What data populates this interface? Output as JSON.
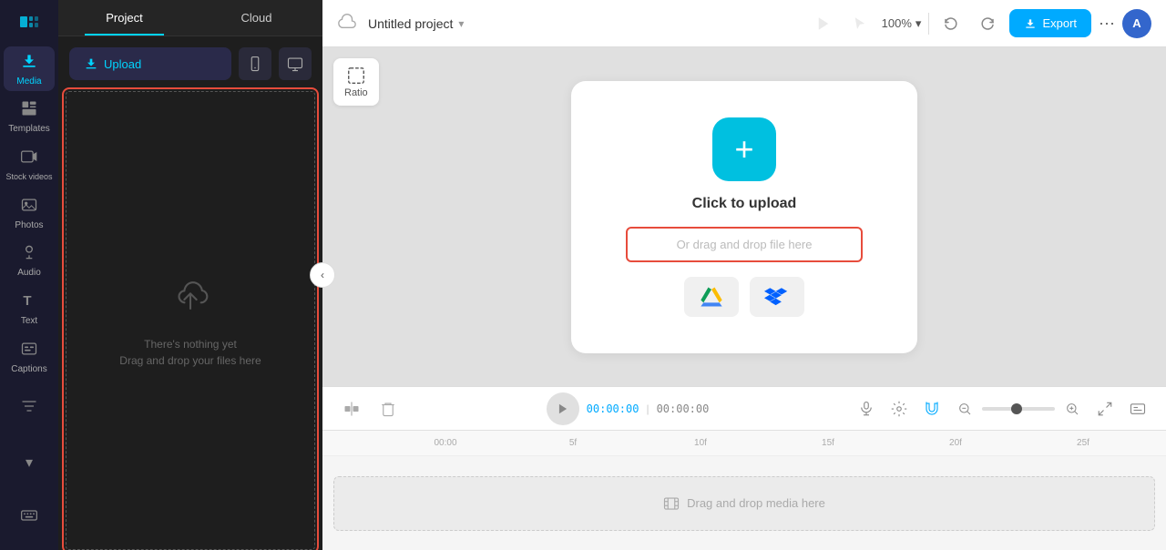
{
  "iconbar": {
    "logo_icon": "✕",
    "items": [
      {
        "id": "media",
        "label": "Media",
        "icon": "⬆",
        "active": true
      },
      {
        "id": "templates",
        "label": "Templates",
        "icon": "⊞",
        "active": false
      },
      {
        "id": "stock_videos",
        "label": "Stock videos",
        "icon": "▦",
        "active": false
      },
      {
        "id": "photos",
        "label": "Photos",
        "icon": "⊡",
        "active": false
      },
      {
        "id": "audio",
        "label": "Audio",
        "icon": "♪",
        "active": false
      },
      {
        "id": "text",
        "label": "Text",
        "icon": "T",
        "active": false
      },
      {
        "id": "captions",
        "label": "Captions",
        "icon": "☰",
        "active": false
      }
    ],
    "bottom_items": [
      {
        "id": "filter",
        "icon": "⚙",
        "label": ""
      },
      {
        "id": "expand",
        "icon": "⬇",
        "label": ""
      },
      {
        "id": "keyboard",
        "icon": "⌨",
        "label": ""
      }
    ]
  },
  "panel": {
    "tab_project": "Project",
    "tab_cloud": "Cloud",
    "upload_btn_label": "Upload",
    "nothing_text": "There's nothing yet",
    "drag_text": "Drag and drop your files here"
  },
  "topbar": {
    "cloud_icon": "☁",
    "project_title": "Untitled project",
    "chevron_icon": "▾",
    "zoom_value": "100%",
    "zoom_chevron": "▾",
    "undo_icon": "↺",
    "redo_icon": "↻",
    "export_icon": "⬆",
    "export_label": "Export",
    "more_icon": "···",
    "avatar_text": "A"
  },
  "canvas": {
    "ratio_label": "Ratio",
    "upload_title": "Click to upload",
    "drag_drop_placeholder": "Or drag and drop file here",
    "collapse_icon": "‹",
    "cloud_upload_icon": "▲",
    "dropbox_icon": "✦"
  },
  "timeline": {
    "cut_icon": "⌷",
    "delete_icon": "🗑",
    "play_icon": "▶",
    "time_current": "00:00:00",
    "time_divider": "|",
    "time_total": "00:00:00",
    "mic_icon": "🎤",
    "grid_icon": "⊞",
    "split_icon": "⊢",
    "zoom_out_icon": "−",
    "zoom_in_icon": "+",
    "fullscreen_icon": "⛶",
    "caption_icon": "☰",
    "ruler_marks": [
      "00:00",
      "5f",
      "10f",
      "15f",
      "20f",
      "25f"
    ],
    "media_drop_label": "Drag and drop media here",
    "film_icon": "🎬"
  }
}
